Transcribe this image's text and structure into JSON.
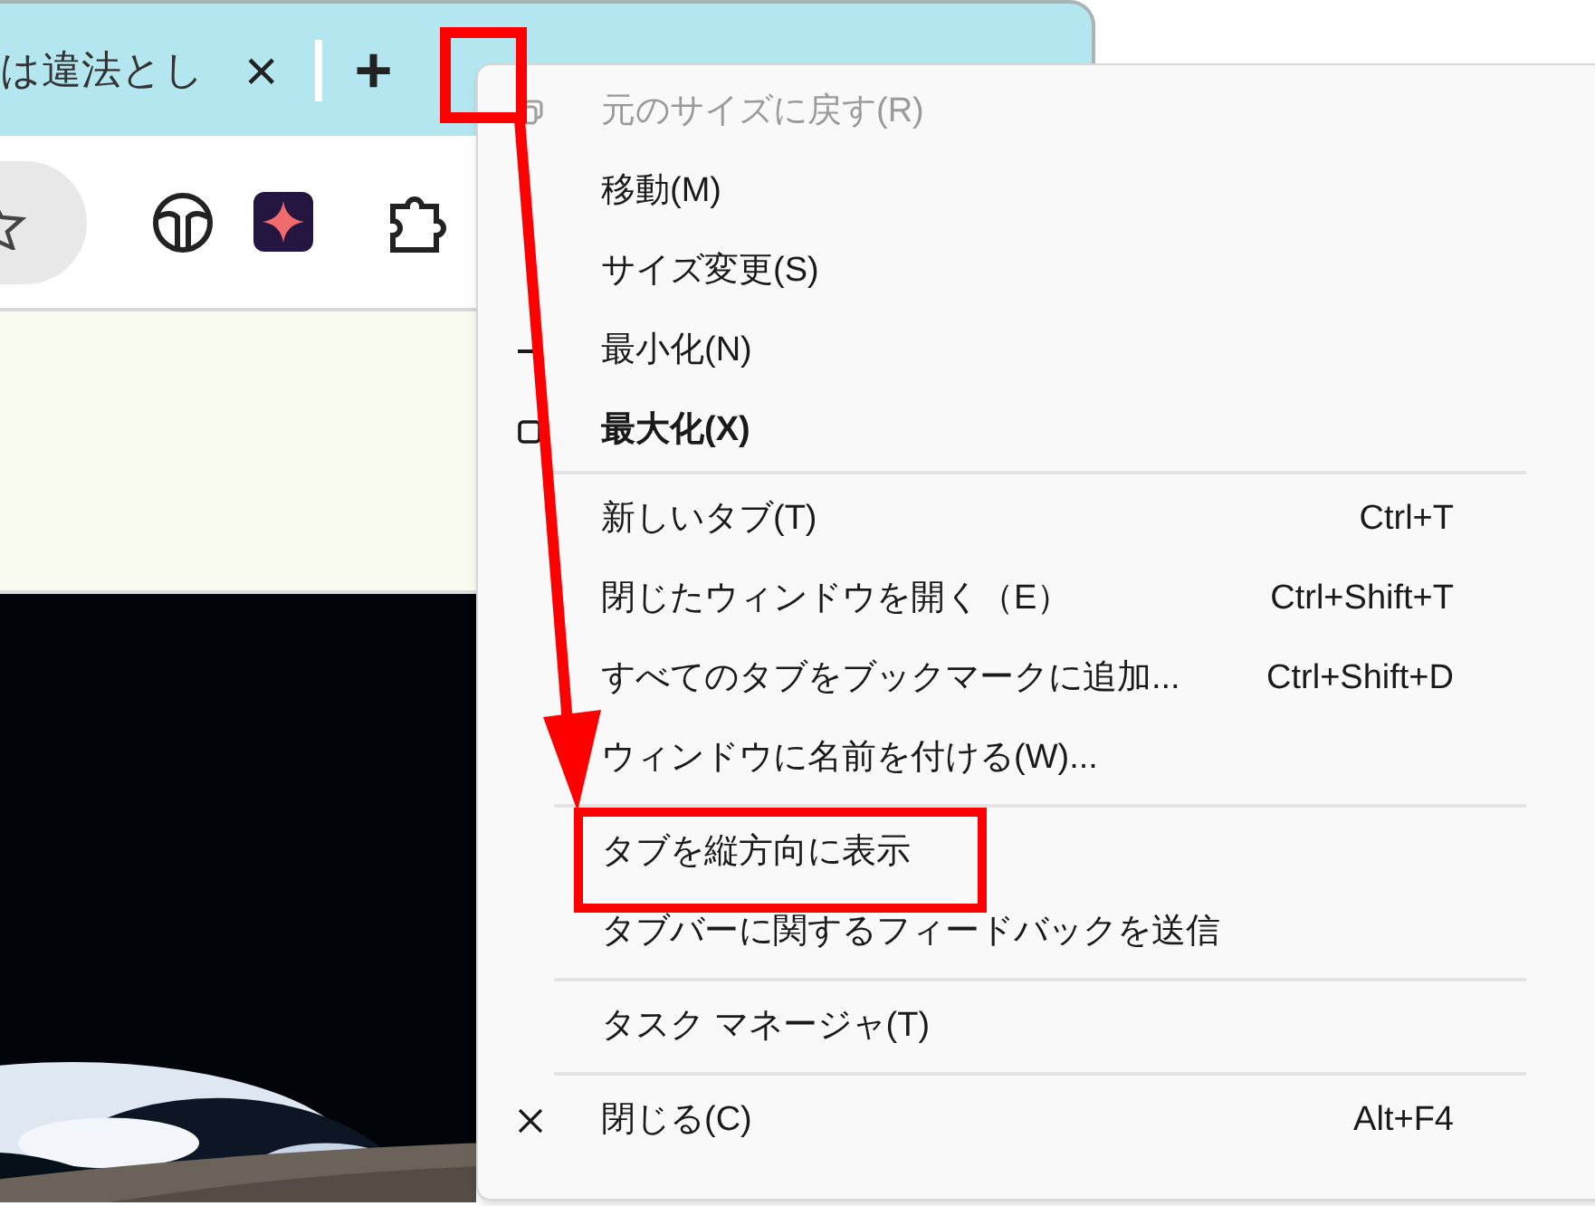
{
  "tab": {
    "title": "は違法とし",
    "close": "×"
  },
  "new_tab": "+",
  "menu": {
    "sections": [
      [
        {
          "kind": "restore",
          "label": "元のサイズに戻す(R)",
          "disabled": true,
          "default": false
        },
        {
          "kind": "plain",
          "label": "移動(M)",
          "disabled": false,
          "default": false
        },
        {
          "kind": "plain",
          "label": "サイズ変更(S)",
          "disabled": false,
          "default": false
        },
        {
          "kind": "minimize",
          "label": "最小化(N)",
          "disabled": false,
          "default": false
        },
        {
          "kind": "maximize",
          "label": "最大化(X)",
          "disabled": false,
          "default": true
        }
      ],
      [
        {
          "kind": "plain",
          "label": "新しいタブ(T)",
          "shortcut": "Ctrl+T",
          "disabled": false,
          "default": false
        },
        {
          "kind": "plain",
          "label": "閉じたウィンドウを開く（E）",
          "shortcut": "Ctrl+Shift+T",
          "disabled": false,
          "default": false
        },
        {
          "kind": "plain",
          "label": "すべてのタブをブックマークに追加...",
          "shortcut": "Ctrl+Shift+D",
          "disabled": false,
          "default": false
        },
        {
          "kind": "plain",
          "label": "ウィンドウに名前を付ける(W)...",
          "disabled": false,
          "default": false
        }
      ],
      [
        {
          "kind": "plain",
          "label": "タブを縦方向に表示",
          "disabled": false,
          "default": false,
          "highlighted": true
        },
        {
          "kind": "plain",
          "label": "タブバーに関するフィードバックを送信",
          "disabled": false,
          "default": false
        }
      ],
      [
        {
          "kind": "plain",
          "label": "タスク マネージャ(T)",
          "disabled": false,
          "default": false
        }
      ],
      [
        {
          "kind": "close",
          "label": "閉じる(C)",
          "shortcut": "Alt+F4",
          "disabled": false,
          "default": false
        }
      ]
    ]
  }
}
